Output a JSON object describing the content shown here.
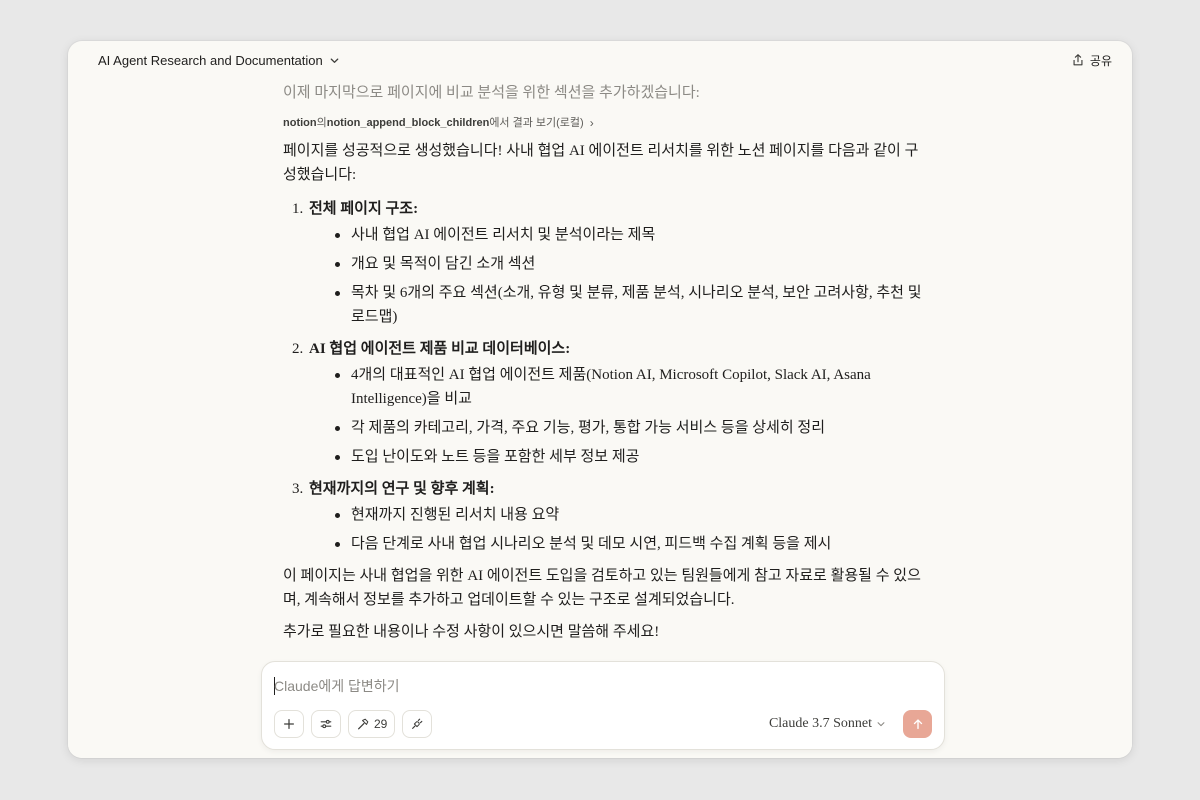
{
  "header": {
    "project_title": "AI Agent Research and Documentation",
    "share_label": "공유"
  },
  "conversation": {
    "faded_line": "이제 마지막으로 페이지에 비교 분석을 위한 섹션을 추가하겠습니다:",
    "tool_call": {
      "app": "notion",
      "connector": "의",
      "function": "notion_append_block_children",
      "suffix": "에서 결과 보기(로컬)"
    },
    "intro": "페이지를 성공적으로 생성했습니다! 사내 협업 AI 에이전트 리서치를 위한 노션 페이지를 다음과 같이 구성했습니다:",
    "sections": [
      {
        "number": "1.",
        "heading": "전체 페이지 구조:",
        "items": [
          "사내 협업 AI 에이전트 리서치 및 분석이라는 제목",
          "개요 및 목적이 담긴 소개 섹션",
          "목차 및 6개의 주요 섹션(소개, 유형 및 분류, 제품 분석, 시나리오 분석, 보안 고려사항, 추천 및 로드맵)"
        ]
      },
      {
        "number": "2.",
        "heading": "AI 협업 에이전트 제품 비교 데이터베이스:",
        "items": [
          "4개의 대표적인 AI 협업 에이전트 제품(Notion AI, Microsoft Copilot, Slack AI, Asana Intelligence)을 비교",
          "각 제품의 카테고리, 가격, 주요 기능, 평가, 통합 가능 서비스 등을 상세히 정리",
          "도입 난이도와 노트 등을 포함한 세부 정보 제공"
        ]
      },
      {
        "number": "3.",
        "heading": "현재까지의 연구 및 향후 계획:",
        "items": [
          "현재까지 진행된 리서치 내용 요약",
          "다음 단계로 사내 협업 시나리오 분석 및 데모 시연, 피드백 수집 계획 등을 제시"
        ]
      }
    ],
    "closing_1": "이 페이지는 사내 협업을 위한 AI 에이전트 도입을 검토하고 있는 팀원들에게 참고 자료로 활용될 수 있으며, 계속해서 정보를 추가하고 업데이트할 수 있는 구조로 설계되었습니다.",
    "closing_2": "추가로 필요한 내용이나 수정 사항이 있으시면 말씀해 주세요!"
  },
  "composer": {
    "placeholder": "Claude에게 답변하기",
    "tools_count": "29",
    "model_label": "Claude 3.7 Sonnet",
    "send_color": "#e8a796"
  },
  "icons": {
    "chevron": "chevron-down-icon",
    "share": "share-icon",
    "plus": "plus-icon",
    "sliders": "sliders-icon",
    "hammer": "hammer-icon",
    "plug": "plug-icon",
    "send": "arrow-up-icon"
  }
}
